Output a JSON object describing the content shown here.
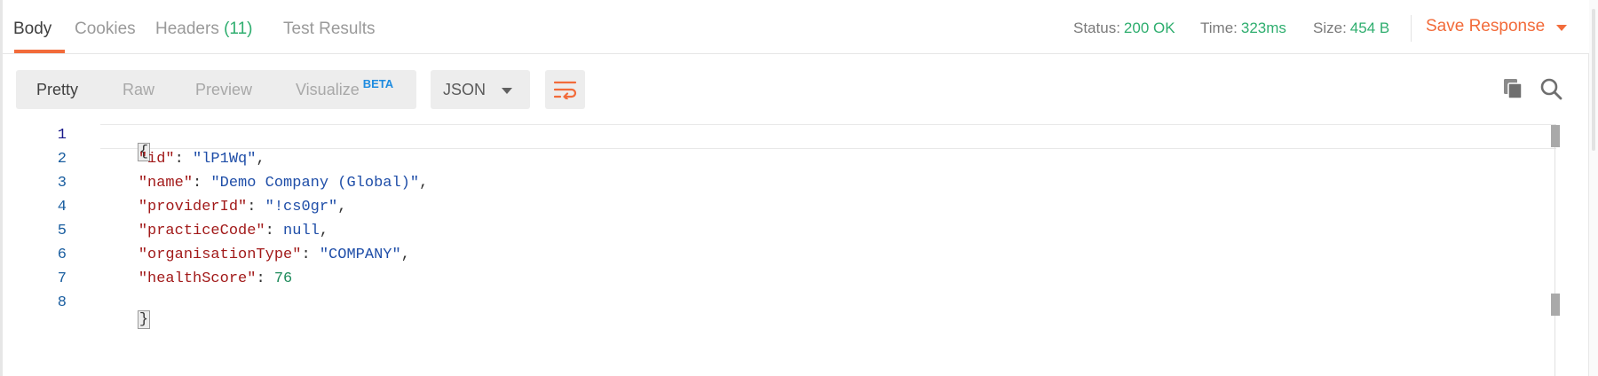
{
  "tabs": [
    {
      "label": "Body",
      "count": ""
    },
    {
      "label": "Cookies",
      "count": ""
    },
    {
      "label": "Headers",
      "count": "(11)"
    },
    {
      "label": "Test Results",
      "count": ""
    }
  ],
  "active_tab": "Body",
  "status": {
    "label": "Status:",
    "value": "200 OK"
  },
  "time": {
    "label": "Time:",
    "value": "323ms"
  },
  "size": {
    "label": "Size:",
    "value": "454 B"
  },
  "save_response": "Save Response",
  "view_modes": [
    {
      "label": "Pretty"
    },
    {
      "label": "Raw"
    },
    {
      "label": "Preview"
    },
    {
      "label": "Visualize",
      "badge": "BETA"
    }
  ],
  "active_view_mode": "Pretty",
  "format_select": "JSON",
  "icons": {
    "wrap": "wrap-lines-icon",
    "copy": "copy-icon",
    "search": "search-icon"
  },
  "colors": {
    "accent": "#f26b3a",
    "success": "#2fae6f",
    "beta": "#1f8ce0",
    "json_key": "#a21a1a",
    "json_string": "#1f4ea8",
    "json_number": "#1d8a5a"
  },
  "code": {
    "line_numbers": [
      "1",
      "2",
      "3",
      "4",
      "5",
      "6",
      "7",
      "8"
    ],
    "open_brace": "{",
    "close_brace": "}",
    "entries": [
      {
        "key": "\"id\"",
        "value": "\"lP1Wq\"",
        "type": "string",
        "trail": ","
      },
      {
        "key": "\"name\"",
        "value": "\"Demo Company (Global)\"",
        "type": "string",
        "trail": ","
      },
      {
        "key": "\"providerId\"",
        "value": "\"!cs0gr\"",
        "type": "string",
        "trail": ","
      },
      {
        "key": "\"practiceCode\"",
        "value": "null",
        "type": "null",
        "trail": ","
      },
      {
        "key": "\"organisationType\"",
        "value": "\"COMPANY\"",
        "type": "string",
        "trail": ","
      },
      {
        "key": "\"healthScore\"",
        "value": "76",
        "type": "number",
        "trail": ""
      }
    ]
  }
}
